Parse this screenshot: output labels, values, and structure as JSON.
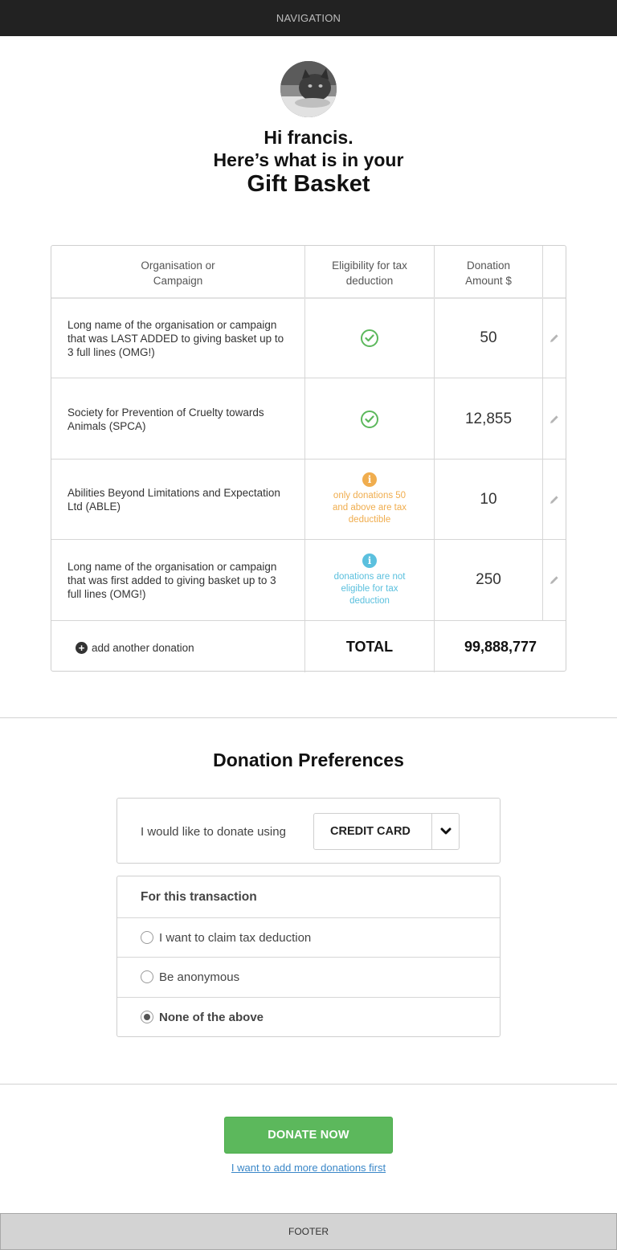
{
  "nav": {
    "label": "NAVIGATION"
  },
  "header": {
    "greeting": "Hi francis.",
    "subtitle": "Here’s what is in your",
    "title": "Gift Basket"
  },
  "table": {
    "headers": {
      "org": "Organisation or Campaign",
      "eligibility": "Eligibility for tax deduction",
      "amount": "Donation Amount $"
    },
    "rows": [
      {
        "org": "Long name of the organisation or campaign that was LAST ADDED to giving basket up to 3 full lines (OMG!)",
        "eligibility": "eligible",
        "note": "",
        "amount": "50"
      },
      {
        "org": "Society for Prevention of Cruelty towards Animals (SPCA)",
        "eligibility": "eligible",
        "note": "",
        "amount": "12,855"
      },
      {
        "org": "Abilities Beyond Limitations and Expectation Ltd (ABLE)",
        "eligibility": "partial",
        "note": "only donations 50 and above are tax deductible",
        "amount": "10"
      },
      {
        "org": "Long name of the organisation or campaign that was first added to giving basket up to 3 full lines (OMG!)",
        "eligibility": "not-eligible",
        "note": "donations are not eligible for tax deduction",
        "amount": "250"
      }
    ],
    "add_label": "add another donation",
    "total_label": "TOTAL",
    "total_value": "99,888,777"
  },
  "preferences": {
    "title": "Donation Preferences",
    "method_label": "I would like to donate using",
    "method_value": "CREDIT CARD",
    "transaction_heading": "For this transaction",
    "options": [
      {
        "label": "I want to claim tax deduction",
        "selected": false
      },
      {
        "label": "Be anonymous",
        "selected": false
      },
      {
        "label": "None of the above",
        "selected": true
      }
    ]
  },
  "actions": {
    "donate_label": "DONATE NOW",
    "more_link": "I want to add more donations first"
  },
  "footer": {
    "label": "FOOTER"
  },
  "colors": {
    "accent_green": "#5cb85c",
    "warning_orange": "#f0ad4e",
    "info_blue": "#5bc0de",
    "link_blue": "#3a87c8",
    "nav_bg": "#222222"
  },
  "icons": {
    "eligible": "check-circle-icon",
    "partial": "info-circle-icon",
    "not-eligible": "info-circle-icon",
    "edit": "pencil-icon",
    "add": "plus-circle-icon",
    "dropdown": "chevron-down-icon"
  }
}
